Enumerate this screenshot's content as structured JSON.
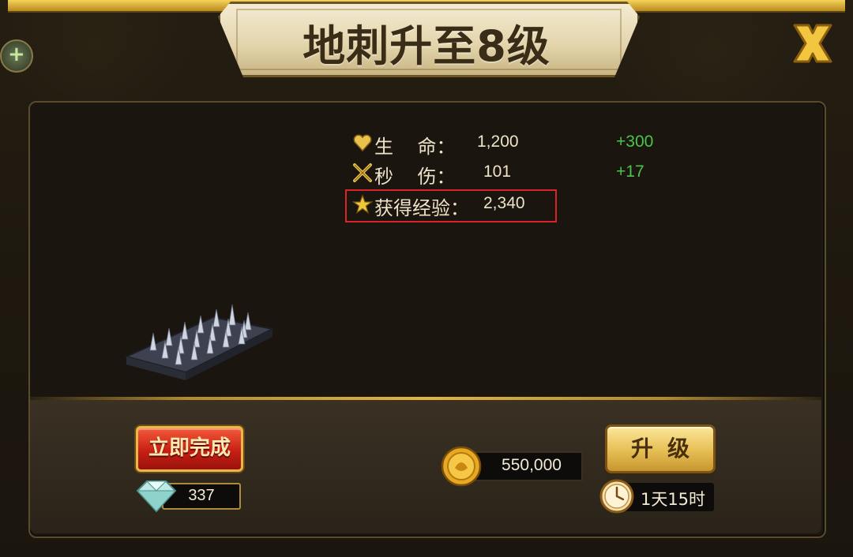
{
  "title": "地刺升至8级",
  "stats": [
    {
      "icon": "heart-icon",
      "label": "生    命：",
      "value": "1,200",
      "bonus": "+300"
    },
    {
      "icon": "crossed-swords-icon",
      "label": "秒    伤：",
      "value": "101",
      "bonus": "+17"
    },
    {
      "icon": "star-icon",
      "label": "获得经验：",
      "value": "2,340",
      "bonus": ""
    }
  ],
  "finish_button": {
    "label": "立即完成"
  },
  "gem_cost": "337",
  "gold_cost": "550,000",
  "upgrade_button": {
    "label": "升级"
  },
  "upgrade_time": "1天15时",
  "colors": {
    "bonus_green": "#4cc44a",
    "highlight_red": "#d8242a",
    "gold_accent": "#e0b545"
  }
}
